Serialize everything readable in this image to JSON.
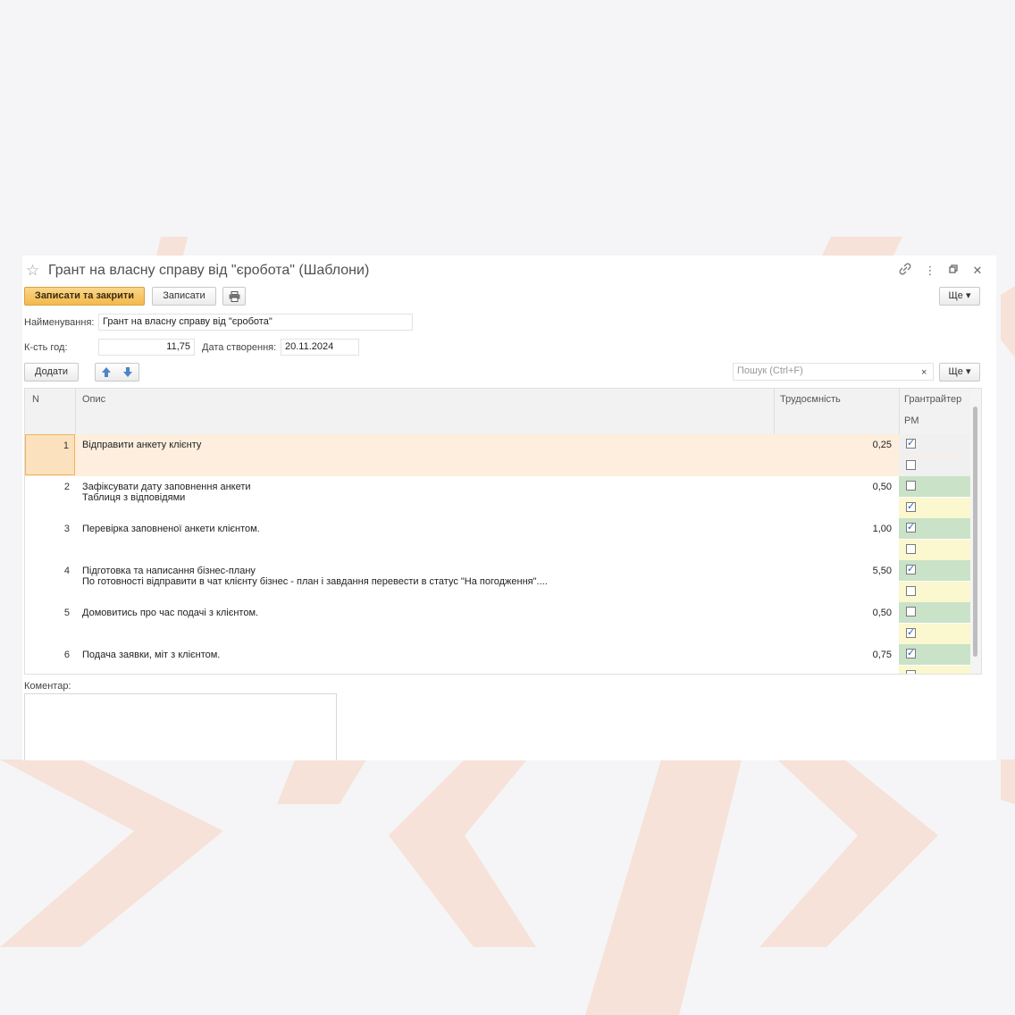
{
  "window": {
    "title": "Грант на власну справу від \"єробота\" (Шаблони)",
    "icons": [
      "star-icon",
      "link-icon",
      "more-vert-icon",
      "restore-icon",
      "close-icon"
    ]
  },
  "toolbar": {
    "save_close_label": "Записати та закрити",
    "save_label": "Записати",
    "print_icon": "printer-icon",
    "more_label": "Ще ▾"
  },
  "form": {
    "name_label": "Найменування:",
    "name_value": "Грант на власну справу від \"єробота\"",
    "hours_label": "К-сть год:",
    "hours_value": "11,75",
    "date_label": "Дата створення:",
    "date_value": "20.11.2024"
  },
  "table_toolbar": {
    "add_label": "Додати",
    "up_icon": "arrow-up-icon",
    "down_icon": "arrow-down-icon",
    "search_placeholder": "Пошук (Ctrl+F)",
    "clear_symbol": "×",
    "more_label": "Ще ▾"
  },
  "table": {
    "columns": {
      "n": "N",
      "description": "Опис",
      "effort": "Трудоємність",
      "grantwriter": "Грантрайтер",
      "pm": "PM"
    },
    "rows": [
      {
        "n": "1",
        "lines": [
          "Відправити анкету клієнту"
        ],
        "hours": "0,25",
        "grantwriter": true,
        "pm": false,
        "selected": true
      },
      {
        "n": "2",
        "lines": [
          "Зафіксувати дату заповнення анкети",
          "Таблиця з відповідями"
        ],
        "hours": "0,50",
        "grantwriter": false,
        "pm": true,
        "selected": false
      },
      {
        "n": "3",
        "lines": [
          "Перевірка заповненої анкети клієнтом."
        ],
        "hours": "1,00",
        "grantwriter": true,
        "pm": false,
        "selected": false
      },
      {
        "n": "4",
        "lines": [
          "Підготовка та написання бізнес-плану",
          "По готовності відправити в чат клієнту бізнес - план і завдання перевести в статус \"На погодження\"...."
        ],
        "hours": "5,50",
        "grantwriter": true,
        "pm": false,
        "selected": false
      },
      {
        "n": "5",
        "lines": [
          "Домовитись про час подачі з клієнтом."
        ],
        "hours": "0,50",
        "grantwriter": false,
        "pm": true,
        "selected": false
      },
      {
        "n": "6",
        "lines": [
          "Подача заявки, міт з клієнтом."
        ],
        "hours": "0,75",
        "grantwriter": true,
        "pm": false,
        "selected": false
      }
    ]
  },
  "comment": {
    "label": "Коментар:"
  },
  "colors": {
    "primary_button": "#f2b94c",
    "selected_row": "#fdeedd",
    "grantwriter_cell": "#c9e2c8",
    "pm_cell": "#fbf7cf",
    "background_shape": "#f6e2d8"
  }
}
